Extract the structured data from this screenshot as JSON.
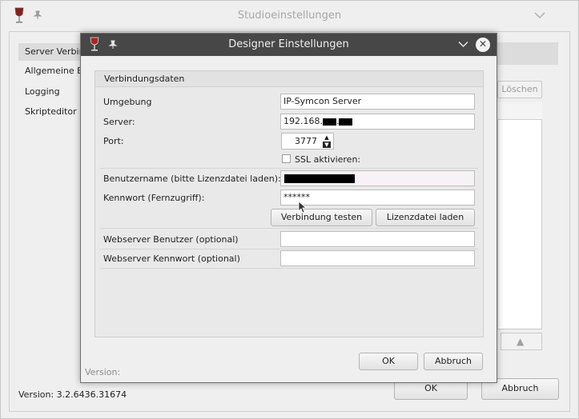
{
  "background_window": {
    "title": "Studioeinstellungen",
    "sidebar": [
      {
        "label": "Server Verbin"
      },
      {
        "label": "Allgemeine E"
      },
      {
        "label": "Logging"
      },
      {
        "label": "Skripteditor"
      }
    ],
    "delete_label": "Löschen",
    "version": "Version: 3.2.6436.31674",
    "ok_label": "OK",
    "cancel_label": "Abbruch"
  },
  "dialog": {
    "title": "Designer Einstellungen",
    "group_title": "Verbindungsdaten",
    "fields": {
      "umgebung": {
        "label": "Umgebung",
        "value": "IP-Symcon Server"
      },
      "server": {
        "label": "Server:",
        "value_prefix": "192.168."
      },
      "port": {
        "label": "Port:",
        "value": "3777"
      },
      "ssl": {
        "label": "SSL aktivieren:",
        "checked": false
      },
      "benutzername": {
        "label": "Benutzername (bitte Lizenzdatei laden):"
      },
      "kennwort": {
        "label": "Kennwort (Fernzugriff):",
        "value": "******"
      },
      "web_user": {
        "label": "Webserver Benutzer (optional)",
        "value": ""
      },
      "web_pass": {
        "label": "Webserver Kennwort (optional)",
        "value": ""
      }
    },
    "test_button": "Verbindung testen",
    "license_button": "Lizenzdatei laden",
    "version_label": "Version:",
    "ok_label": "OK",
    "cancel_label": "Abbruch"
  },
  "icons": {
    "app": "wine-glass-icon",
    "pin": "pin-icon",
    "minimize": "chevron-down-icon",
    "close": "close-icon"
  },
  "colors": {
    "dialog_titlebar": "#474747",
    "window_bg": "#efefef"
  }
}
